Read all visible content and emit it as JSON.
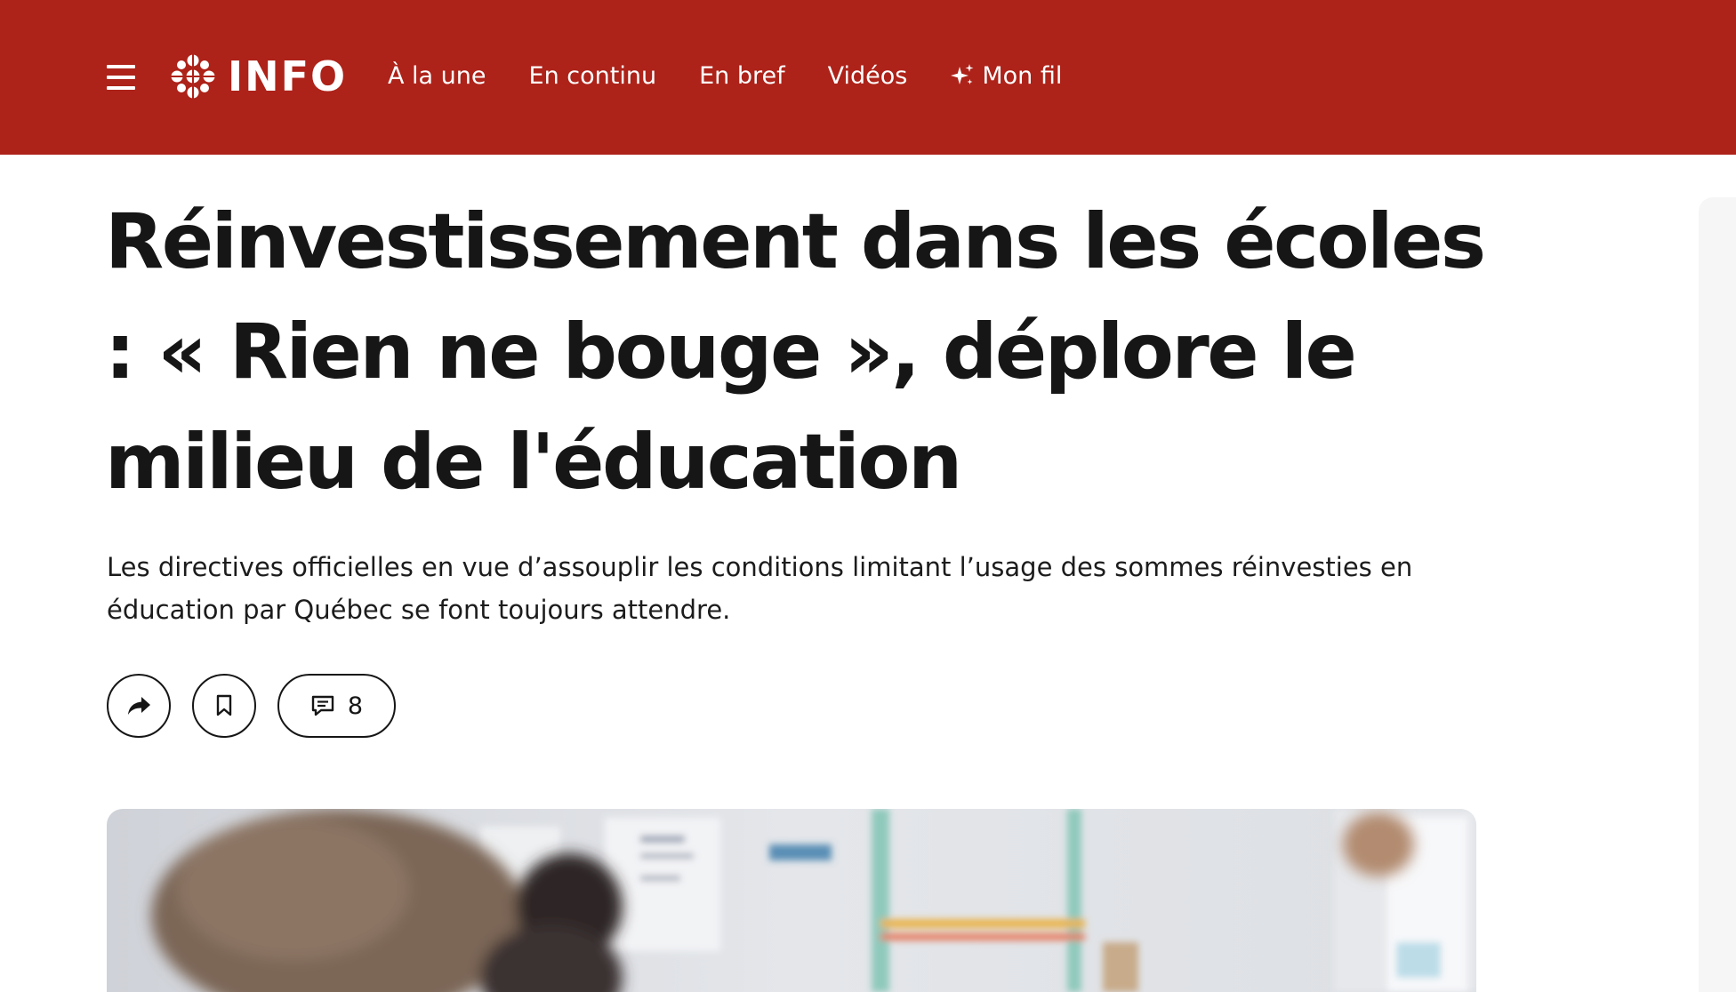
{
  "colors": {
    "brand": "#ad2219"
  },
  "header": {
    "logo_text": "INFO",
    "logo_icon": "radio-canada-gem-icon",
    "menu_icon": "hamburger-menu-icon",
    "nav": [
      {
        "label": "À la une"
      },
      {
        "label": "En continu"
      },
      {
        "label": "En bref"
      },
      {
        "label": "Vidéos"
      },
      {
        "label": "Mon fil",
        "icon": "sparkle-icon"
      }
    ]
  },
  "article": {
    "title": "Réinvestissement dans les écoles : « Rien ne bouge », déplore le milieu de l'éducation",
    "lede": "Les directives officielles en vue d’assouplir les conditions limitant l’usage des sommes réinvesties en éducation par Québec se font toujours attendre.",
    "actions": {
      "share_icon": "share-arrow-icon",
      "bookmark_icon": "bookmark-icon",
      "comments_icon": "comment-icon",
      "comment_count": "8"
    }
  }
}
